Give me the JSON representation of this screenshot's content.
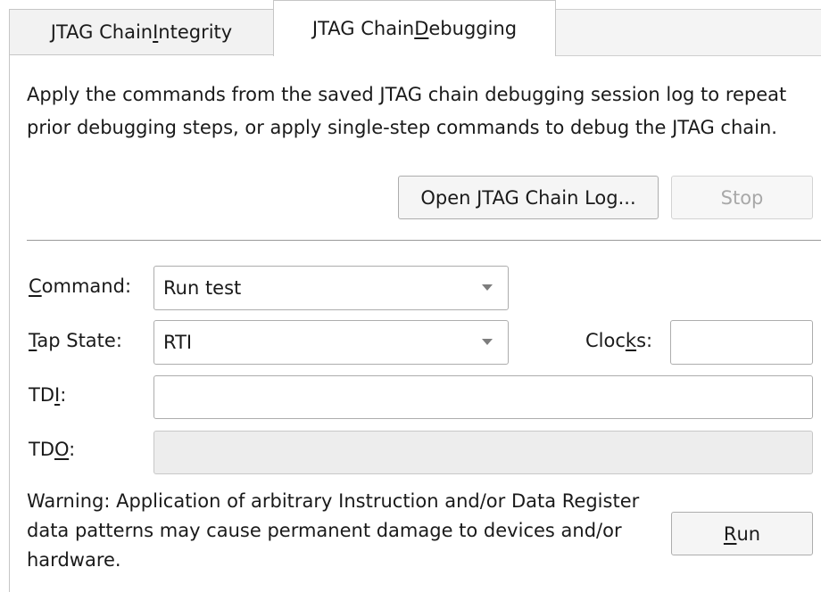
{
  "tabs": {
    "integrity": {
      "pre": "JTAG Chain ",
      "mn": "I",
      "post": "ntegrity"
    },
    "debugging": {
      "pre": "JTAG Chain ",
      "mn": "D",
      "post": "ebugging"
    }
  },
  "description": "Apply the commands from the saved JTAG chain debugging session log to repeat prior debugging steps, or apply single-step commands to debug the JTAG chain.",
  "buttons": {
    "open_log": "Open JTAG Chain Log...",
    "stop": "Stop",
    "run": {
      "pre": "",
      "mn": "R",
      "post": "un"
    }
  },
  "command": {
    "label": {
      "pre": "",
      "mn": "C",
      "post": "ommand:"
    },
    "value": "Run test"
  },
  "tap_state": {
    "label": {
      "pre": "",
      "mn": "T",
      "post": "ap State:"
    },
    "value": "RTI"
  },
  "clocks": {
    "label": {
      "pre": "Cloc",
      "mn": "k",
      "post": "s:"
    },
    "value": ""
  },
  "tdi": {
    "label": {
      "pre": "TD",
      "mn": "I",
      "post": ":"
    },
    "value": ""
  },
  "tdo": {
    "label": {
      "pre": "TD",
      "mn": "O",
      "post": ":"
    },
    "value": ""
  },
  "warning": "Warning: Application of arbitrary Instruction and/or Data Register data patterns may cause permanent damage to devices and/or hardware."
}
